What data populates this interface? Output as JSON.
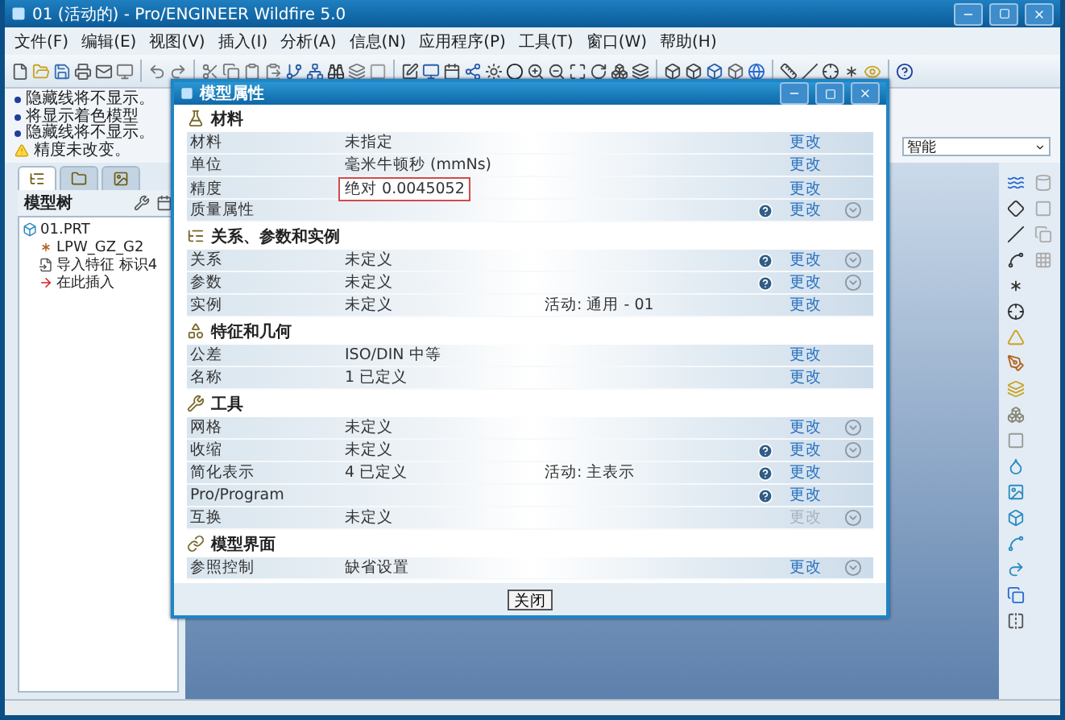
{
  "window": {
    "title": "01 (活动的) - Pro/ENGINEER Wildfire 5.0"
  },
  "menu": [
    "文件(F)",
    "编辑(E)",
    "视图(V)",
    "插入(I)",
    "分析(A)",
    "信息(N)",
    "应用程序(P)",
    "工具(T)",
    "窗口(W)",
    "帮助(H)"
  ],
  "messages": [
    {
      "kind": "info",
      "text": "隐藏线将不显示。"
    },
    {
      "kind": "info",
      "text": "将显示着色模型"
    },
    {
      "kind": "info",
      "text": "隐藏线将不显示。"
    },
    {
      "kind": "warning",
      "text": "精度未改变。"
    }
  ],
  "filter": {
    "value": "智能"
  },
  "navigator": {
    "tabs": [
      {
        "selected": true
      },
      {
        "selected": false
      },
      {
        "selected": false
      }
    ]
  },
  "model_tree": {
    "title": "模型树",
    "items": [
      {
        "kind": "part",
        "label": "01.PRT",
        "children": [
          {
            "kind": "csys",
            "label": "LPW_GZ_G2"
          },
          {
            "kind": "import",
            "label": "导入特征 标识4"
          },
          {
            "kind": "insert",
            "label": "在此插入"
          }
        ]
      }
    ]
  },
  "dialog": {
    "title": "模型属性",
    "close_button": "关闭",
    "sections": [
      {
        "title": "材料",
        "rows": [
          {
            "label": "材料",
            "value": "未指定",
            "info": false,
            "expand": false,
            "action": "更改",
            "action_disabled": false,
            "highlighted": false
          },
          {
            "label": "单位",
            "value": "毫米牛顿秒 (mmNs)",
            "info": false,
            "expand": false,
            "action": "更改",
            "action_disabled": false,
            "highlighted": false
          },
          {
            "label": "精度",
            "value": "绝对 0.0045052",
            "info": false,
            "expand": false,
            "action": "更改",
            "action_disabled": false,
            "highlighted": true
          },
          {
            "label": "质量属性",
            "info": true,
            "expand": true,
            "action": "更改",
            "action_disabled": false
          }
        ]
      },
      {
        "title": "关系、参数和实例",
        "rows": [
          {
            "label": "关系",
            "value": "未定义",
            "info": true,
            "expand": true,
            "action": "更改",
            "action_disabled": false,
            "highlighted": false
          },
          {
            "label": "参数",
            "value": "未定义",
            "info": true,
            "expand": true,
            "action": "更改",
            "action_disabled": false,
            "highlighted": false
          },
          {
            "label": "实例",
            "value": "未定义",
            "note": "活动: 通用 - 01",
            "info": false,
            "expand": false,
            "action": "更改",
            "action_disabled": false,
            "highlighted": false
          }
        ]
      },
      {
        "title": "特征和几何",
        "rows": [
          {
            "label": "公差",
            "value": "ISO/DIN 中等",
            "info": false,
            "expand": false,
            "action": "更改",
            "action_disabled": false,
            "highlighted": false
          },
          {
            "label": "名称",
            "value": "1 已定义",
            "info": false,
            "expand": false,
            "action": "更改",
            "action_disabled": false,
            "highlighted": false
          }
        ]
      },
      {
        "title": "工具",
        "rows": [
          {
            "label": "网格",
            "value": "未定义",
            "info": false,
            "expand": true,
            "action": "更改",
            "action_disabled": false,
            "highlighted": false
          },
          {
            "label": "收缩",
            "value": "未定义",
            "info": true,
            "expand": true,
            "action": "更改",
            "action_disabled": false,
            "highlighted": false
          },
          {
            "label": "简化表示",
            "value": "4 已定义",
            "note": "活动: 主表示",
            "info": true,
            "expand": false,
            "action": "更改",
            "action_disabled": false,
            "highlighted": false
          },
          {
            "label": "Pro/Program",
            "info": true,
            "expand": false,
            "action": "更改",
            "action_disabled": false
          },
          {
            "label": "互换",
            "value": "未定义",
            "info": false,
            "expand": true,
            "action": "更改",
            "action_disabled": true,
            "highlighted": false
          }
        ]
      },
      {
        "title": "模型界面",
        "rows": [
          {
            "label": "参照控制",
            "value": "缺省设置",
            "info": false,
            "expand": true,
            "action": "更改",
            "action_disabled": false,
            "highlighted": false
          }
        ]
      }
    ]
  }
}
